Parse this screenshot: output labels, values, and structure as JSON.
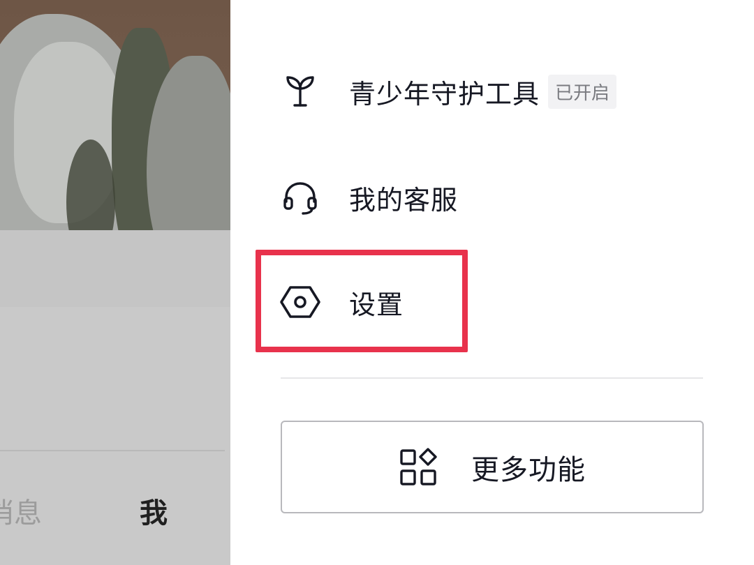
{
  "background_app": {
    "tabs": [
      {
        "label": "消息"
      },
      {
        "label": "我"
      }
    ]
  },
  "drawer": {
    "items": [
      {
        "label": "青少年守护工具",
        "badge": "已开启",
        "icon": "sprout-icon"
      },
      {
        "label": "我的客服",
        "icon": "headset-icon"
      },
      {
        "label": "设置",
        "icon": "settings-hexagon-icon"
      }
    ],
    "more_button": {
      "label": "更多功能",
      "icon": "grid-icon"
    }
  },
  "colors": {
    "highlight": "#e8324c",
    "text_primary": "#161823",
    "badge_text": "#7a7b80",
    "badge_bg": "#f2f2f4"
  }
}
